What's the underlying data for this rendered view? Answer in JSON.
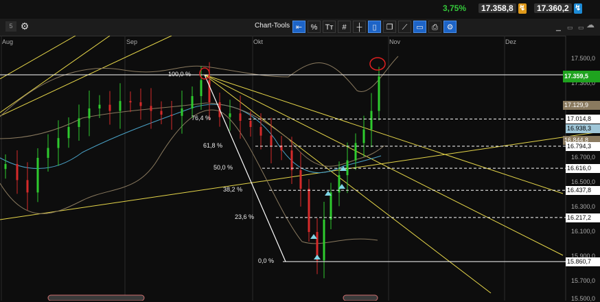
{
  "header": {
    "percent": "3,75%",
    "bid": "17.358,8",
    "ask": "17.360,2",
    "percent_color": "#35c83b",
    "bid_arrow_icon": "bolt-icon",
    "ask_arrow_icon": "bolt-icon"
  },
  "toolbar": {
    "page_indicator": "5",
    "chart_tools_label": "Chart-Tools",
    "tools": [
      {
        "name": "back-arrow-icon",
        "glyph": "⇤",
        "active": true
      },
      {
        "name": "percent-icon",
        "glyph": "%",
        "active": false
      },
      {
        "name": "text-icon",
        "glyph": "Tт",
        "active": false
      },
      {
        "name": "grid-icon",
        "glyph": "#",
        "active": false
      },
      {
        "name": "crosshair-icon",
        "glyph": "┼",
        "active": false
      },
      {
        "name": "candle-icon",
        "glyph": "▯",
        "active": true
      },
      {
        "name": "layers-icon",
        "glyph": "❐",
        "active": false
      },
      {
        "name": "draw-trendline-icon",
        "glyph": "⟋",
        "active": false
      },
      {
        "name": "shape-icon",
        "glyph": "▭",
        "active": true
      },
      {
        "name": "print-icon",
        "glyph": "⎙",
        "active": false
      },
      {
        "name": "settings-icon",
        "glyph": "⚙",
        "active": true
      }
    ]
  },
  "months": [
    "Aug",
    "Sep",
    "Okt",
    "Nov",
    "Dez"
  ],
  "axis_ticks": [
    "17.500,0",
    "17.300,0",
    "16.700,0",
    "16.500,0",
    "16.300,0",
    "16.100,0",
    "15.900,0",
    "15.700,0",
    "15.500,0"
  ],
  "price_tags": [
    {
      "value": "17.359,5",
      "bg": "#1fa31f",
      "fg": "#ffffff",
      "price": 17359.5
    },
    {
      "value": "17.129,9",
      "bg": "#8a7a5f",
      "fg": "#ffffff",
      "price": 17129.9
    },
    {
      "value": "17.014,8",
      "bg": "#ffffff",
      "fg": "#000000",
      "price": 17014.8
    },
    {
      "value": "16.938,3",
      "bg": "#9fc6d8",
      "fg": "#000000",
      "price": 16938.3
    },
    {
      "value": "16.844,8",
      "bg": "#8a7a5f",
      "fg": "#ffffff",
      "price": 16844.8
    },
    {
      "value": "16.794,3",
      "bg": "#ffffff",
      "fg": "#000000",
      "price": 16794.3
    },
    {
      "value": "16.616,0",
      "bg": "#ffffff",
      "fg": "#000000",
      "price": 16616.0
    },
    {
      "value": "16.437,8",
      "bg": "#ffffff",
      "fg": "#000000",
      "price": 16437.8
    },
    {
      "value": "16.217,2",
      "bg": "#ffffff",
      "fg": "#000000",
      "price": 16217.2
    },
    {
      "value": "15.860,7",
      "bg": "#ffffff",
      "fg": "#000000",
      "price": 15860.7
    }
  ],
  "fib_levels": [
    {
      "label": "100,0 %",
      "price": 17372
    },
    {
      "label": "76,4 %",
      "price": 17014.8
    },
    {
      "label": "61,8 %",
      "price": 16794.3
    },
    {
      "label": "50,0 %",
      "price": 16616.0
    },
    {
      "label": "38,2 %",
      "price": 16437.8
    },
    {
      "label": "23,6 %",
      "price": 16217.2
    },
    {
      "label": "0,0 %",
      "price": 15860.7
    }
  ],
  "chart_data": {
    "type": "candlestick",
    "x_labels": [
      "Aug",
      "Sep",
      "Okt",
      "Nov",
      "Dez"
    ],
    "y_range": [
      15650,
      17600
    ],
    "last_price": 17359.5,
    "fibonacci": {
      "high": 17372,
      "low": 15860.7,
      "levels": [
        "100,0 %",
        "76,4 %",
        "61,8 %",
        "50,0 %",
        "38,2 %",
        "23,6 %",
        "0,0 %"
      ]
    },
    "colors": {
      "up": "#2ecc2e",
      "down": "#d62a2a",
      "fib": "#ffffff",
      "trend": "#e8d84a",
      "bollinger": "#8a7a5f",
      "ma": "#4aa3c8",
      "marker": "#e02020"
    }
  }
}
